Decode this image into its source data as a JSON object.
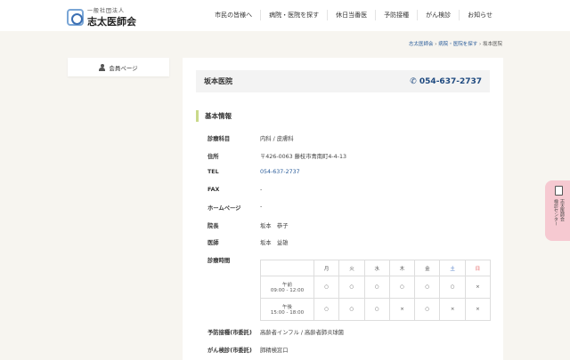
{
  "header": {
    "logo_sub": "一般社団法人",
    "logo_main": "志太医師会",
    "nav": [
      "市民の皆様へ",
      "病院・医院を探す",
      "休日当番医",
      "予防接種",
      "がん検診",
      "お知らせ"
    ]
  },
  "breadcrumb": [
    "志太医師会",
    "病院・医院を探す",
    "坂本医院"
  ],
  "sidebar": {
    "member_label": "会員ページ"
  },
  "clinic": {
    "name": "坂本医院",
    "tel": "054-637-2737"
  },
  "section_title": "基本情報",
  "info": [
    {
      "label": "診療科目",
      "value": "内科 / 皮膚科"
    },
    {
      "label": "住所",
      "value": "〒426-0063 藤枝市青南町4-4-13"
    },
    {
      "label": "TEL",
      "value": "054-637-2737"
    },
    {
      "label": "FAX",
      "value": "-"
    },
    {
      "label": "ホームページ",
      "value": "-"
    },
    {
      "label": "院長",
      "value": "坂本　恭子"
    },
    {
      "label": "医師",
      "value": "坂本　益雄"
    },
    {
      "label": "診療時間",
      "value": ""
    },
    {
      "label": "予防接種(市委託)",
      "value": "高齢者インフル / 高齢者肺炎球菌"
    },
    {
      "label": "がん検診(市委託)",
      "value": "肺精検窓口"
    }
  ],
  "hours": {
    "days": [
      "月",
      "火",
      "水",
      "木",
      "金",
      "土",
      "日"
    ],
    "rows": [
      {
        "label": "午前",
        "time": "09:00 - 12:00",
        "marks": [
          "○",
          "○",
          "○",
          "○",
          "○",
          "○",
          "×"
        ]
      },
      {
        "label": "午後",
        "time": "15:00 - 18:00",
        "marks": [
          "○",
          "○",
          "○",
          "×",
          "○",
          "×",
          "×"
        ]
      }
    ]
  },
  "side_tab": {
    "line1": "志太医師会",
    "line2": "検診センター"
  }
}
